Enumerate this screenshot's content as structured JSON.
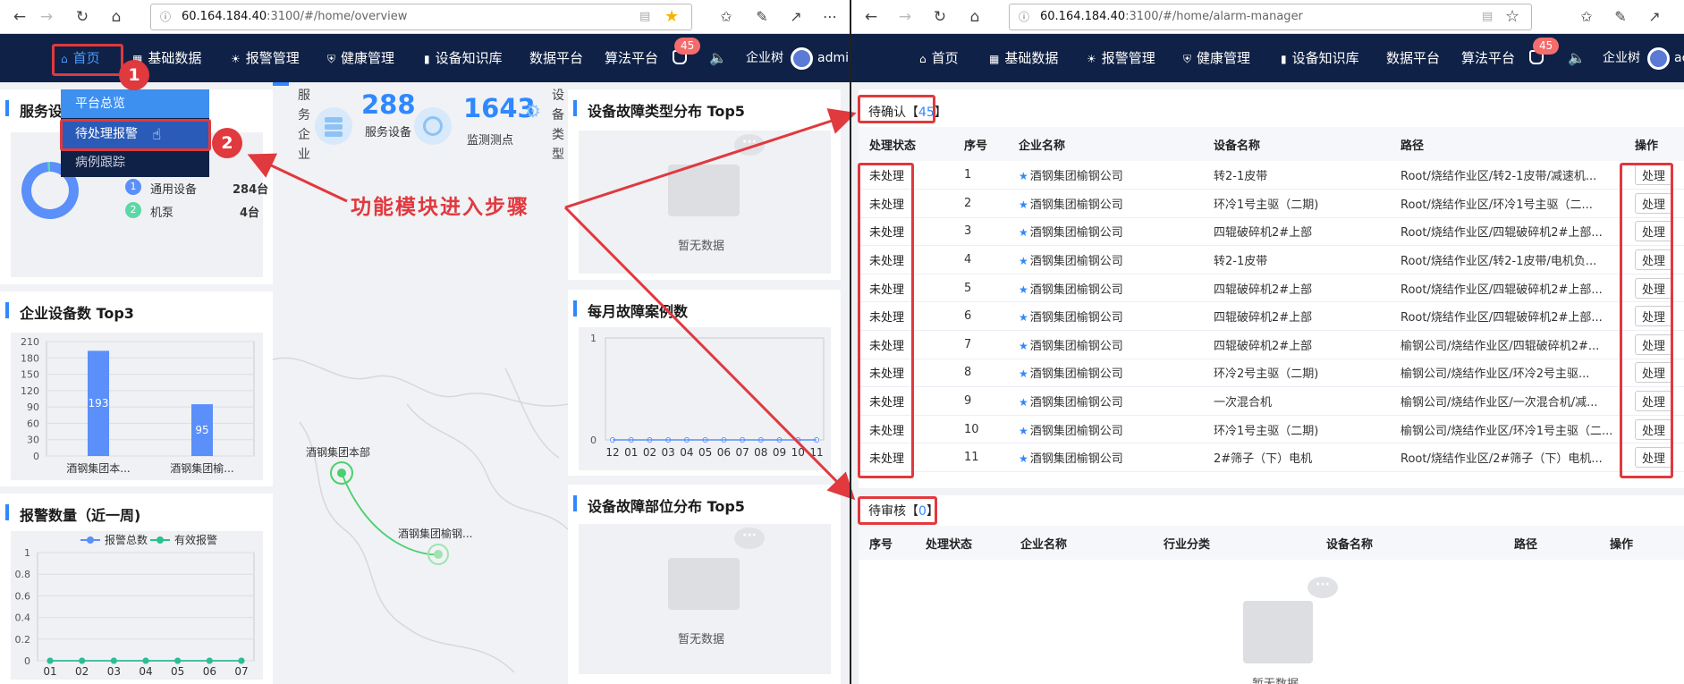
{
  "left_window": {
    "address": {
      "host": "60.164.184.40",
      "path": ":3100/#/home/overview"
    },
    "nav": [
      {
        "label": "首页",
        "icon": "home-icon"
      },
      {
        "label": "基础数据",
        "icon": "grid-icon"
      },
      {
        "label": "报警管理",
        "icon": "alarm-icon"
      },
      {
        "label": "健康管理",
        "icon": "shield-icon"
      },
      {
        "label": "设备知识库",
        "icon": "book-icon"
      },
      {
        "label": "数据平台",
        "icon": ""
      },
      {
        "label": "算法平台",
        "icon": ""
      }
    ],
    "badge": "45",
    "enterprise_tree": "企业树",
    "user": "admin",
    "dropdown": [
      "平台总览",
      "待处理报警",
      "病例跟踪"
    ],
    "service_panel": {
      "title": "服务设",
      "legend": [
        {
          "num": "1",
          "label": "通用设备",
          "value": "284台",
          "color": "#5b8ff9"
        },
        {
          "num": "2",
          "label": "机泵",
          "value": "4台",
          "color": "#5ad8a6"
        }
      ]
    },
    "stats": {
      "service_enterprise_label": "服务企业",
      "devices_value": "288",
      "devices_label": "服务设备",
      "points_value": "1643",
      "points_label": "监测测点",
      "device_type_label": "设备类型"
    },
    "top3_panel": {
      "title": "企业设备数 Top3"
    },
    "alarm_panel": {
      "title": "报警数量（近一周)"
    },
    "fault_type_panel": {
      "title": "设备故障类型分布 Top5",
      "empty": "暂无数据"
    },
    "monthly_panel": {
      "title": "每月故障案例数"
    },
    "fault_part_panel": {
      "title": "设备故障部位分布 Top5",
      "empty": "暂无数据"
    },
    "map": {
      "labels": [
        "酒钢集团本部",
        "酒钢集团榆钢..."
      ]
    }
  },
  "annotation": {
    "step1": "1",
    "step2": "2",
    "text": "功能模块进入步骤"
  },
  "right_window": {
    "address": {
      "host": "60.164.184.40",
      "path": ":3100/#/home/alarm-manager"
    },
    "nav": [
      {
        "label": "首页",
        "icon": "home-icon"
      },
      {
        "label": "基础数据",
        "icon": "grid-icon"
      },
      {
        "label": "报警管理",
        "icon": "alarm-icon"
      },
      {
        "label": "健康管理",
        "icon": "shield-icon"
      },
      {
        "label": "设备知识库",
        "icon": "book-icon"
      },
      {
        "label": "数据平台",
        "icon": ""
      },
      {
        "label": "算法平台",
        "icon": ""
      }
    ],
    "badge": "45",
    "enterprise_tree": "企业树",
    "user": "ac",
    "pending": {
      "label_prefix": "待确认【",
      "count": "45",
      "label_suffix": "】"
    },
    "pending_headers": [
      "处理状态",
      "序号",
      "企业名称",
      "设备名称",
      "路径",
      "操作"
    ],
    "pending_rows": [
      {
        "status": "未处理",
        "no": "1",
        "company": "酒钢集团榆钢公司",
        "device": "转2-1皮带",
        "path": "Root/烧结作业区/转2-1皮带/减速机...",
        "action": "处理"
      },
      {
        "status": "未处理",
        "no": "2",
        "company": "酒钢集团榆钢公司",
        "device": "环冷1号主驱（二期)",
        "path": "Root/烧结作业区/环冷1号主驱（二...",
        "action": "处理"
      },
      {
        "status": "未处理",
        "no": "3",
        "company": "酒钢集团榆钢公司",
        "device": "四辊破碎机2#上部",
        "path": "Root/烧结作业区/四辊破碎机2#上部...",
        "action": "处理"
      },
      {
        "status": "未处理",
        "no": "4",
        "company": "酒钢集团榆钢公司",
        "device": "转2-1皮带",
        "path": "Root/烧结作业区/转2-1皮带/电机负...",
        "action": "处理"
      },
      {
        "status": "未处理",
        "no": "5",
        "company": "酒钢集团榆钢公司",
        "device": "四辊破碎机2#上部",
        "path": "Root/烧结作业区/四辊破碎机2#上部...",
        "action": "处理"
      },
      {
        "status": "未处理",
        "no": "6",
        "company": "酒钢集团榆钢公司",
        "device": "四辊破碎机2#上部",
        "path": "Root/烧结作业区/四辊破碎机2#上部...",
        "action": "处理"
      },
      {
        "status": "未处理",
        "no": "7",
        "company": "酒钢集团榆钢公司",
        "device": "四辊破碎机2#上部",
        "path": "榆钢公司/烧结作业区/四辊破碎机2#...",
        "action": "处理"
      },
      {
        "status": "未处理",
        "no": "8",
        "company": "酒钢集团榆钢公司",
        "device": "环冷2号主驱（二期)",
        "path": "榆钢公司/烧结作业区/环冷2号主驱...",
        "action": "处理"
      },
      {
        "status": "未处理",
        "no": "9",
        "company": "酒钢集团榆钢公司",
        "device": "一次混合机",
        "path": "榆钢公司/烧结作业区/一次混合机/减...",
        "action": "处理"
      },
      {
        "status": "未处理",
        "no": "10",
        "company": "酒钢集团榆钢公司",
        "device": "环冷1号主驱（二期)",
        "path": "榆钢公司/烧结作业区/环冷1号主驱（二...",
        "action": "处理"
      },
      {
        "status": "未处理",
        "no": "11",
        "company": "酒钢集团榆钢公司",
        "device": "2#筛子（下）电机",
        "path": "Root/烧结作业区/2#筛子（下）电机...",
        "action": "处理"
      }
    ],
    "review": {
      "label_prefix": "待审核【",
      "count": "0",
      "label_suffix": "】"
    },
    "review_headers": [
      "序号",
      "处理状态",
      "企业名称",
      "行业分类",
      "设备名称",
      "路径",
      "操作"
    ],
    "review_empty": "暂无数据"
  },
  "chart_data": [
    {
      "type": "pie",
      "title": "服务设",
      "categories": [
        "通用设备",
        "机泵"
      ],
      "values": [
        284,
        4
      ]
    },
    {
      "type": "bar",
      "title": "企业设备数 Top3",
      "categories": [
        "酒钢集团本...",
        "酒钢集团榆..."
      ],
      "values": [
        193,
        95
      ],
      "ylim": [
        0,
        210
      ],
      "yticks": [
        0,
        30,
        60,
        90,
        120,
        150,
        180,
        210
      ]
    },
    {
      "type": "line",
      "title": "报警数量（近一周)",
      "x": [
        "01",
        "02",
        "03",
        "04",
        "05",
        "06",
        "07"
      ],
      "series": [
        {
          "name": "报警总数",
          "values": [
            0,
            0,
            0,
            0,
            0,
            0,
            0
          ]
        },
        {
          "name": "有效报警",
          "values": [
            0,
            0,
            0,
            0,
            0,
            0,
            0
          ]
        }
      ],
      "ylim": [
        0,
        1
      ],
      "yticks": [
        "0",
        "0.2",
        "0.4",
        "0.6",
        "0.8",
        "1"
      ]
    },
    {
      "type": "line",
      "title": "每月故障案例数",
      "x": [
        "12",
        "01",
        "02",
        "03",
        "04",
        "05",
        "06",
        "07",
        "08",
        "09",
        "10",
        "11"
      ],
      "series": [
        {
          "values": [
            0,
            0,
            0,
            0,
            0,
            0,
            0,
            0,
            0,
            0,
            0,
            0
          ]
        }
      ],
      "ylim": [
        0,
        1
      ],
      "yticks": [
        "0",
        "1"
      ]
    }
  ]
}
